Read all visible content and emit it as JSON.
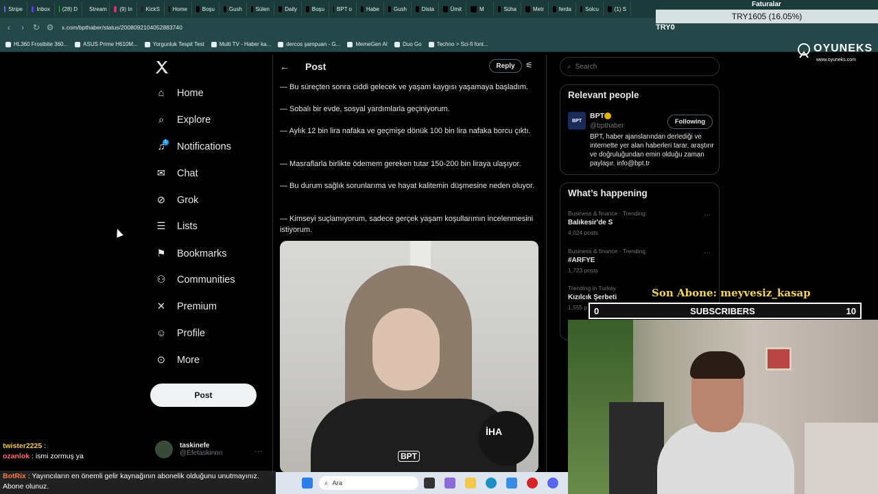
{
  "browser": {
    "tabs": [
      {
        "label": "Stripe",
        "color": "#7a5af8"
      },
      {
        "label": "Inbox",
        "color": "#6a3ad8"
      },
      {
        "label": "(28) D",
        "color": "#3fb950"
      },
      {
        "label": "Stream",
        "color": "#53fc18"
      },
      {
        "label": "(9) In",
        "color": "#e1306c"
      },
      {
        "label": "KickS",
        "color": "#222222"
      },
      {
        "label": "Home",
        "color": "#000000"
      },
      {
        "label": "Boşu",
        "color": "#000000"
      },
      {
        "label": "Gush",
        "color": "#000000"
      },
      {
        "label": "Sülen",
        "color": "#000000"
      },
      {
        "label": "Daily",
        "color": "#000000"
      },
      {
        "label": "Boşu",
        "color": "#000000"
      },
      {
        "label": "BPT o",
        "color": "#000000"
      },
      {
        "label": "Habe",
        "color": "#000000"
      },
      {
        "label": "Gush",
        "color": "#000000"
      },
      {
        "label": "Dista",
        "color": "#000000"
      },
      {
        "label": "Ümit",
        "color": "#000000"
      },
      {
        "label": "M",
        "color": "#000000"
      },
      {
        "label": "Süha",
        "color": "#000000"
      },
      {
        "label": "Metr",
        "color": "#000000"
      },
      {
        "label": "ferda",
        "color": "#000000"
      },
      {
        "label": "Solcu",
        "color": "#000000"
      },
      {
        "label": "(1) S",
        "color": "#000000"
      }
    ],
    "url": "x.com/bpthaber/status/2008092104052883740",
    "bookmarks": [
      "HL360 Frostbite 360...",
      "ASUS Prime H610M...",
      "Yorgunluk Tespit Test",
      "Multi TV - Haber ka...",
      "dercos şampuan - G...",
      "MemeGen AI",
      "Duo Go",
      "Techno > Sci-fi font..."
    ],
    "faturalar": "Faturalar",
    "currency": "TRY1605 (16.05%)",
    "try_label": "TRY0"
  },
  "nav": {
    "items": [
      {
        "label": "Home",
        "icon": "home-icon"
      },
      {
        "label": "Explore",
        "icon": "search-icon"
      },
      {
        "label": "Notifications",
        "icon": "bell-icon"
      },
      {
        "label": "Chat",
        "icon": "mail-icon"
      },
      {
        "label": "Grok",
        "icon": "grok-icon"
      },
      {
        "label": "Lists",
        "icon": "list-icon"
      },
      {
        "label": "Bookmarks",
        "icon": "bookmark-icon"
      },
      {
        "label": "Communities",
        "icon": "people-icon"
      },
      {
        "label": "Premium",
        "icon": "x-icon"
      },
      {
        "label": "Profile",
        "icon": "person-icon"
      },
      {
        "label": "More",
        "icon": "more-icon"
      }
    ],
    "notification_count": "1",
    "post_button": "Post",
    "account": {
      "name": "taskinefe",
      "handle": "@Efetaskinnn"
    }
  },
  "post": {
    "title": "Post",
    "reply_button": "Reply",
    "paragraphs": [
      "— Bu süreçten sonra ciddi gelecek ve yaşam kaygısı yaşamaya başladım.",
      "— Sobalı bir evde, sosyal yardımlarla geçiniyorum.",
      "— Aylık 12 bin lira nafaka ve geçmişe dönük 100 bin lira nafaka borcu çıktı.",
      "— Masraflarla birlikte ödemem gereken tutar 150-200 bin liraya ulaşıyor.",
      "— Bu durum sağlık sorunlarıma ve hayat kalitemin düşmesine neden oluyor.",
      "— Kimseyi suçlamıyorum, sadece gerçek yaşam koşullarımın incelenmesini istiyorum."
    ],
    "media_watermark": "BPT",
    "mic_logo": "İHA"
  },
  "sidebar": {
    "search_placeholder": "Search",
    "relevant_title": "Relevant people",
    "person": {
      "name": "BPT",
      "handle": "@bpthaber",
      "follow_button": "Following",
      "bio": "BPT, haber ajanslarından derlediği ve internette yer alan haberleri tarar, araştırır ve doğruluğundan emin olduğu zaman paylaşır. info@bpt.tr"
    },
    "whats_happening": "What’s happening",
    "trends": [
      {
        "meta": "Business & finance · Trending",
        "name": "Balıkesir'de S",
        "posts": "4,024 posts"
      },
      {
        "meta": "Business & finance · Trending",
        "name": "#ARFYE",
        "posts": "1,723 posts"
      },
      {
        "meta": "Trending in Turkey",
        "name": "Kızılcık Şerbeti",
        "posts": "1,555 p"
      }
    ]
  },
  "overlay": {
    "brand": "OYUNEKS",
    "brand_url": "www.oyuneks.com",
    "last_sub": "Son Abone: meyvesiz_kasap",
    "subs_left": "0",
    "subs_label": "SUBSCRIBERS",
    "subs_right": "10"
  },
  "chat": [
    {
      "user": "twister2225",
      "user_color": "#f2c94c",
      "text": ":"
    },
    {
      "user": "ozanlok",
      "user_color": "#ff6b6b",
      "text": ": ismi zormuş ya"
    }
  ],
  "chat_bot": {
    "user": "BotRix",
    "user_color": "#ff7a45",
    "text": ": Yayıncıların en önemli gelir kaynağının abonelik olduğunu unutmayınız. Abone olunuz."
  },
  "taskbar": {
    "search_placeholder": "Ara"
  }
}
